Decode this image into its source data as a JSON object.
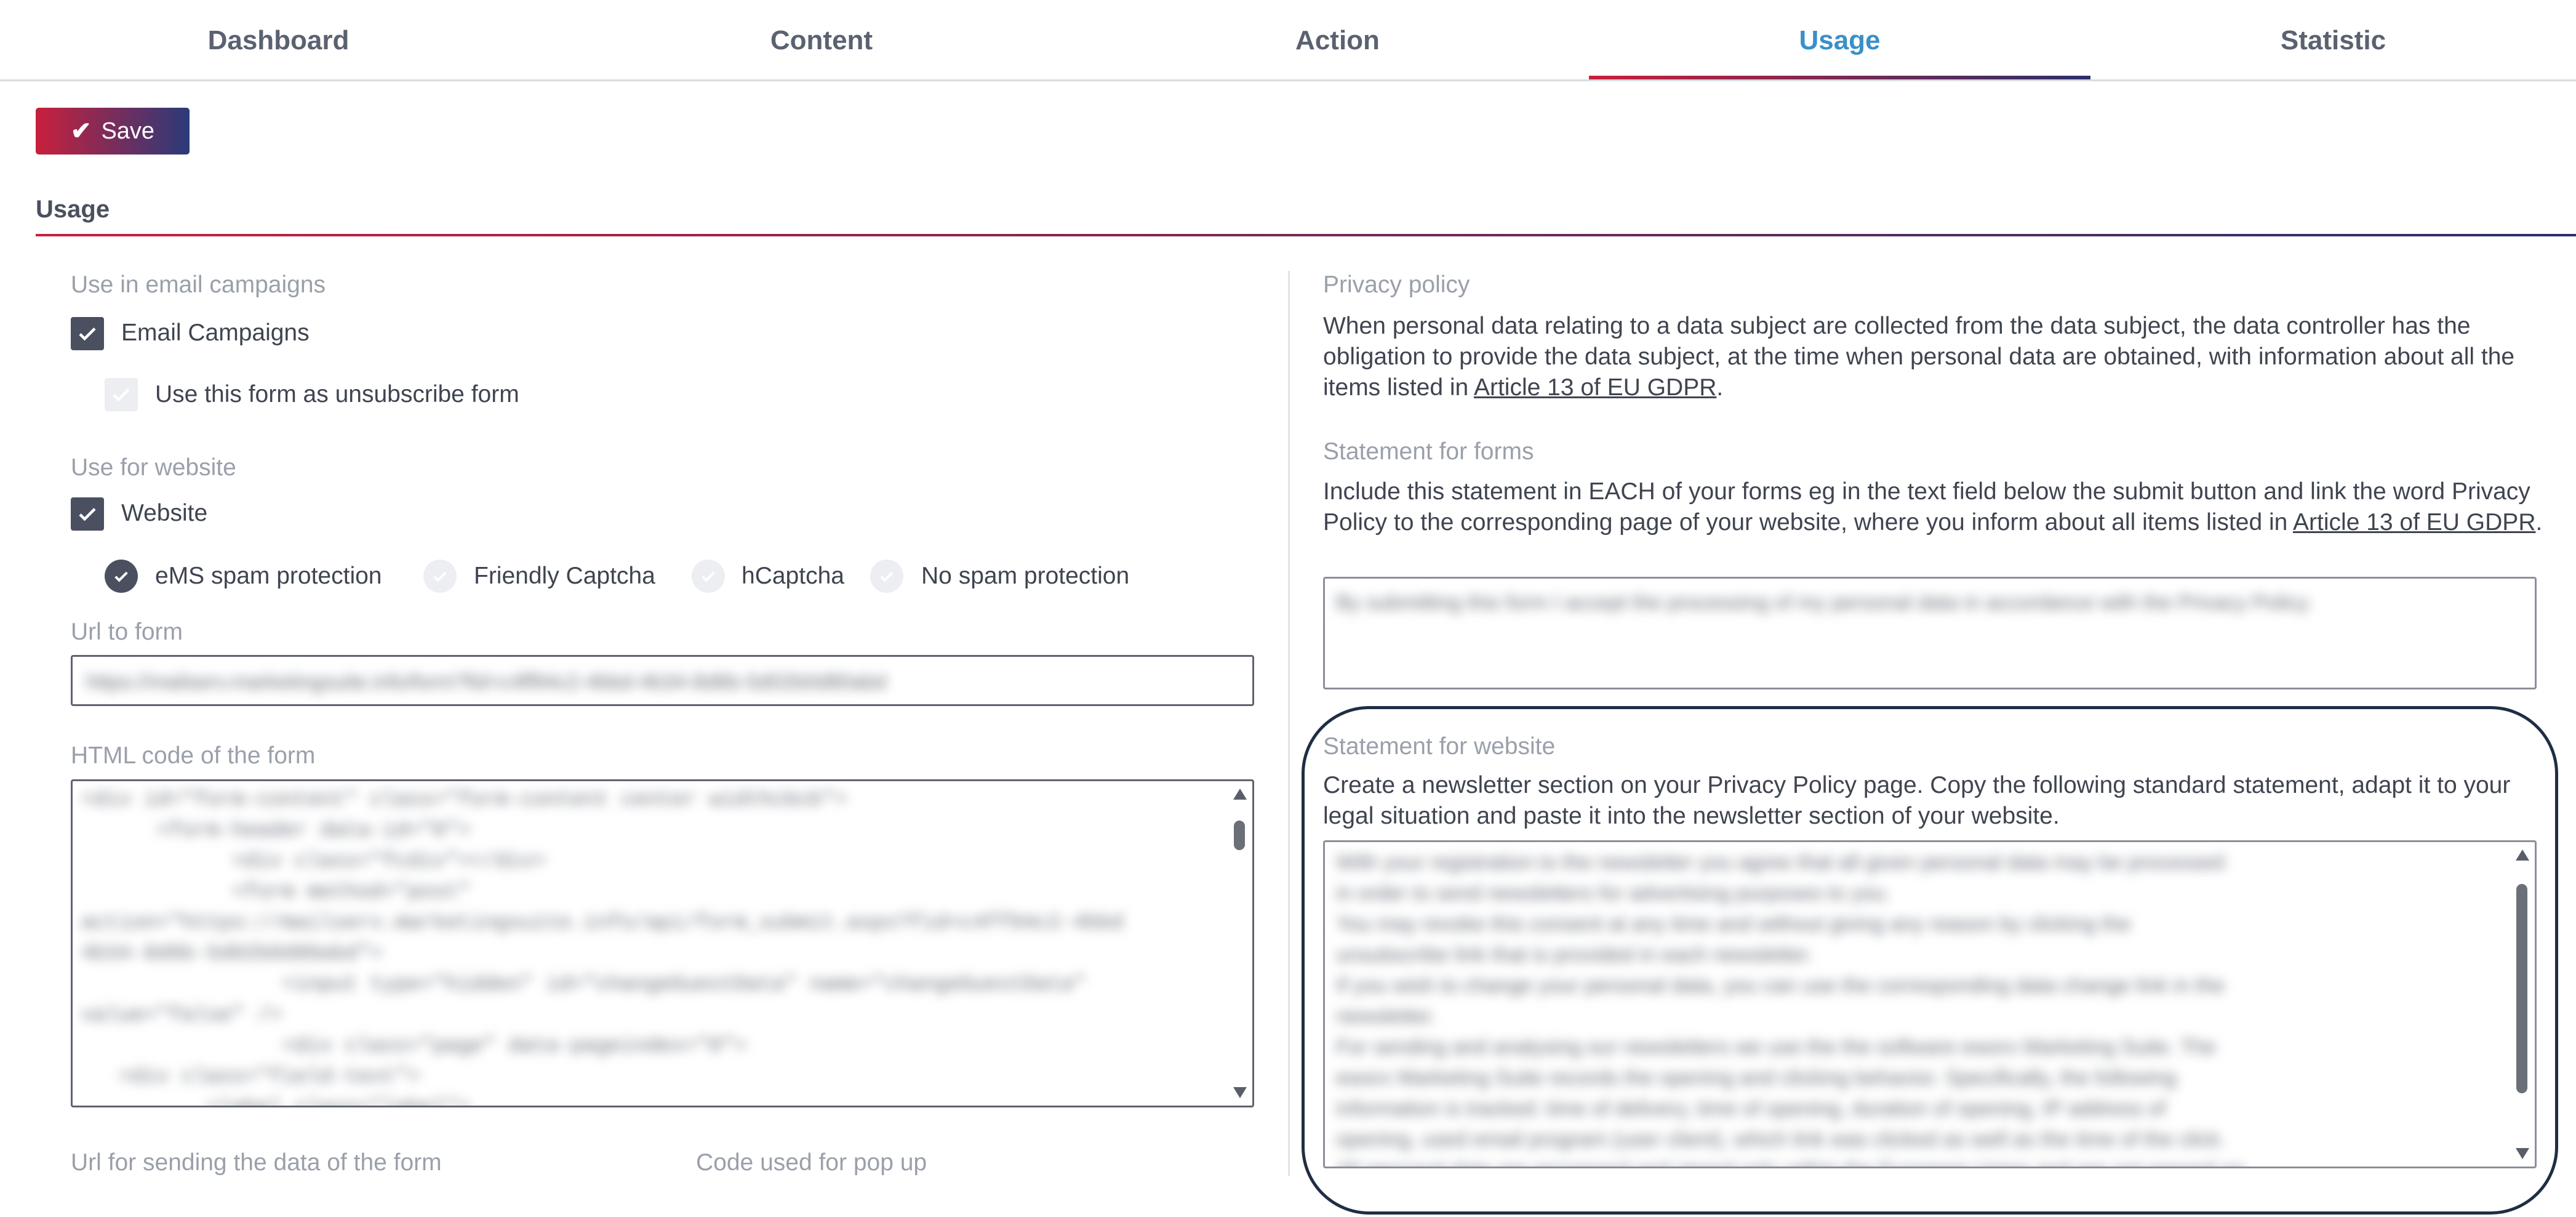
{
  "tabs": [
    {
      "label": "Dashboard"
    },
    {
      "label": "Content"
    },
    {
      "label": "Action"
    },
    {
      "label": "Usage",
      "active": true
    },
    {
      "label": "Statistic"
    }
  ],
  "toolbar": {
    "save_label": "Save"
  },
  "section": {
    "title": "Usage"
  },
  "left": {
    "email_group_label": "Use in email campaigns",
    "email_campaigns": {
      "label": "Email Campaigns",
      "checked": true
    },
    "unsubscribe": {
      "label": "Use this form as unsubscribe form",
      "checked": false,
      "disabled": true
    },
    "website_group_label": "Use for website",
    "website": {
      "label": "Website",
      "checked": true
    },
    "spam_options": [
      {
        "label": "eMS spam protection",
        "selected": true
      },
      {
        "label": "Friendly Captcha",
        "selected": false
      },
      {
        "label": "hCaptcha",
        "selected": false
      },
      {
        "label": "No spam protection",
        "selected": false
      }
    ],
    "url_label": "Url to form",
    "url_value": "https://mailserv.marketingsuite.info/form?fid=c4ff94c2-4bbd-4b34-8d6b-5d02b0d80abd",
    "html_label": "HTML code of the form",
    "html_lines": [
      "<div id=\"form-content\" class=\"form-content center widthcbcb\">",
      "      <form-header data-id=\"0\">",
      "            <div class=\"fcdiv\"></div>",
      "            <form method=\"post\"",
      "action=\"https://mailserv.marketingsuite.info/api/form_submit.aspx?fid=c4ff94c2-4bbd",
      "4b34-8d6b-5d02b0d80abd\">",
      "                <input type=\"hidden\" id=\"changeGuestData\" name=\"changeGuestData\"",
      "value=\"false\" />",
      "                <div class=\"page\" data-pageindex=\"0\">",
      "   <div class=\"field-text\">",
      "          <label class=\"label\">"
    ],
    "sending_url_label": "Url for sending the data of the form",
    "popup_code_label": "Code used for pop up"
  },
  "right": {
    "privacy_label": "Privacy policy",
    "privacy_text": "When personal data relating to a data subject are collected from the data subject, the data controller has the obligation to provide the data subject, at the time when personal data are obtained, with information about all the items listed in",
    "privacy_link": "Article 13 of EU GDPR",
    "forms_label": "Statement for forms",
    "forms_text": "Include this statement in EACH of your forms eg in the text field below the submit button and link the word Privacy Policy to the corresponding page of your website, where you inform about all items listed in",
    "forms_link": "Article 13 of EU GDPR",
    "forms_statement": "By submitting this form I accept the processing of my personal data in accordance with the Privacy Policy.",
    "website_label": "Statement for website",
    "website_text": "Create a newsletter section on your Privacy Policy page. Copy the following standard statement, adapt it to your legal situation and paste it into the newsletter section of your website.",
    "website_statement": [
      "With your registration to the newsletter you agree that all given personal data may be processed",
      "in order to send newsletters for advertising purposes to you.",
      "You may revoke this consent at any time and without giving any reason by clicking the",
      "unsubscribe link that is provided in each newsletter.",
      "If you wish to change your personal data, you can use the corresponding data change link in the",
      "newsletter.",
      "For sending and analysing our newsletters we use the the software eworx Marketing Suite. The",
      "eworx Marketing Suite records the opening and clicking behavior. Specifically, the following",
      "information is tracked: time of delivery, time of opening, duration of opening, IP address of",
      "opening, used email program (user client), which link was clicked as well as the time of the click.",
      "All personal data are processed and stored only within the European Union and are not passed on."
    ]
  },
  "colors": {
    "accent": "#3a8fc9",
    "brand_red": "#c8203c",
    "brand_navy": "#2b2f6b",
    "checkbox": "#4a5060"
  },
  "icons": [
    "check-icon",
    "scroll-up-icon",
    "scroll-down-icon"
  ]
}
